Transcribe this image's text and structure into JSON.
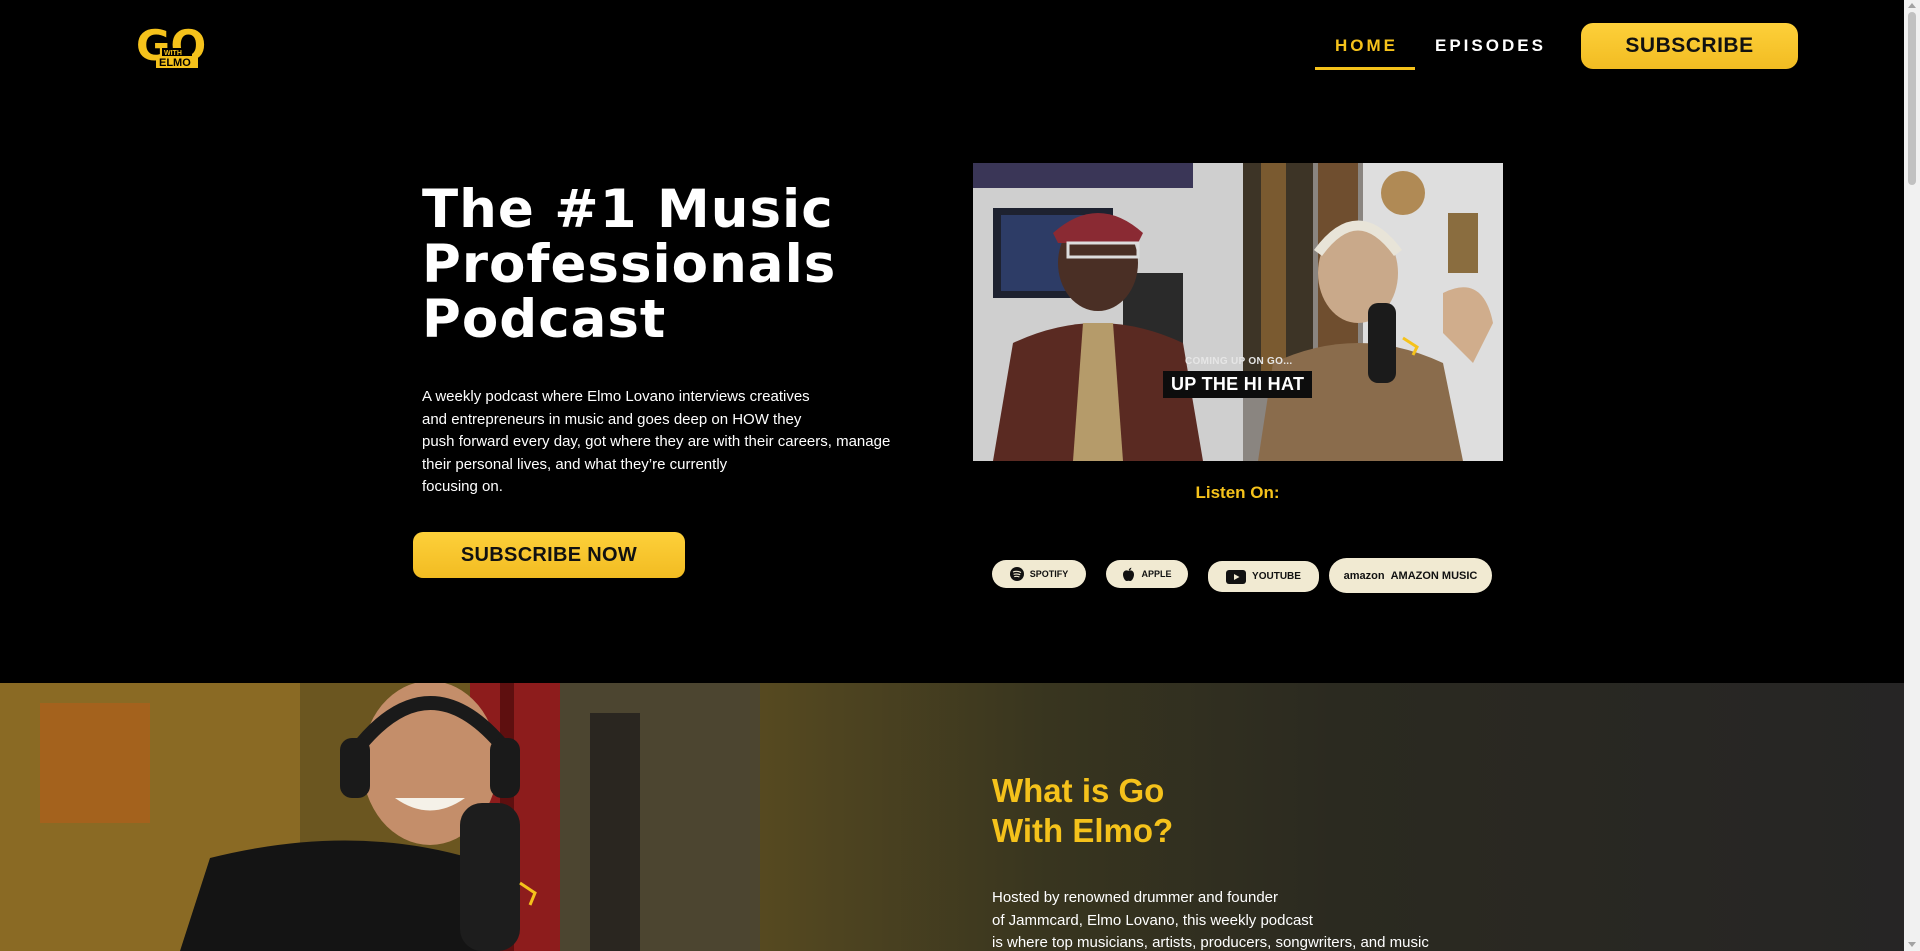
{
  "brand": {
    "logo_text": "GO",
    "logo_subtext_top": "WITH",
    "logo_subtext_bottom": "ELMO"
  },
  "nav": {
    "items": [
      {
        "label": "HOME",
        "active": true
      },
      {
        "label": "EPISODES",
        "active": false
      }
    ],
    "subscribe_label": "SUBSCRIBE"
  },
  "hero": {
    "title_lines": [
      "The #1 Music",
      "Professionals",
      "Podcast"
    ],
    "description_lines": [
      "A weekly podcast where Elmo Lovano interviews creatives",
      "and entrepreneurs in music and goes deep on HOW they",
      "push forward every day, got where they are with their careers, manage",
      "their personal lives, and what they’re currently",
      "focusing on."
    ],
    "cta_label": "SUBSCRIBE NOW"
  },
  "video": {
    "caption_small": "COMING UP ON GO...",
    "caption_big": "UP THE HI HAT"
  },
  "listen": {
    "heading": "Listen On:",
    "platforms": [
      {
        "label": "SPOTIFY",
        "icon": "spotify-icon"
      },
      {
        "label": "APPLE",
        "icon": "apple-icon"
      },
      {
        "label": "YOUTUBE",
        "icon": "youtube-icon"
      },
      {
        "label": "AMAZON MUSIC",
        "icon": "amazon-logo",
        "icon_text": "amazon"
      }
    ]
  },
  "about": {
    "title_lines": [
      "What is Go",
      "With Elmo?"
    ],
    "body_lines": [
      "Hosted by renowned drummer and founder",
      "of Jammcard, Elmo Lovano, this weekly podcast",
      "is where top musicians, artists, producers, songwriters, and music"
    ]
  },
  "colors": {
    "accent": "#f5c21b",
    "background": "#000000",
    "pill": "#f1ead2"
  }
}
